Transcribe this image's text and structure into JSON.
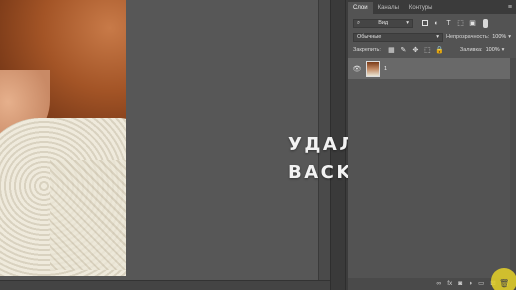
{
  "canvas": {
    "caption_line1": "УДАЛИТЬ СЛОЙ:",
    "caption_line2": "BACKSPACE"
  },
  "panel": {
    "tabs": [
      {
        "label": "Слои",
        "active": true
      },
      {
        "label": "Каналы",
        "active": false
      },
      {
        "label": "Контуры",
        "active": false
      }
    ],
    "menu_icon": "≡",
    "filter": {
      "kind_label": "Вид"
    },
    "blend_mode": "Обычные",
    "opacity_label": "Непрозрачность:",
    "opacity_value": "100%",
    "lock_label": "Закрепить:",
    "fill_label": "Заливка:",
    "fill_value": "100%",
    "layers": [
      {
        "name": "1",
        "visible": true
      }
    ]
  },
  "colors": {
    "canvas_bg": "#575757",
    "panel_bg": "#535353",
    "selected_layer": "#696969",
    "cursor_highlight": "#e6d228"
  }
}
